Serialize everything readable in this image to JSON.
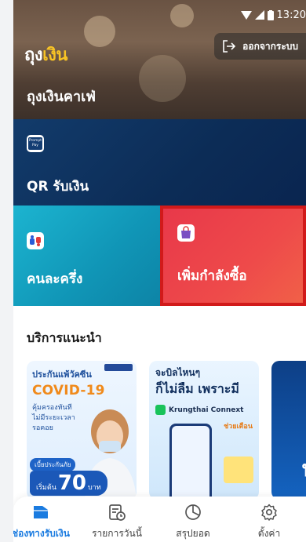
{
  "status_bar": {
    "time": "13:20"
  },
  "header": {
    "logo_part1": "ถุง",
    "logo_part2": "เงิน",
    "logout_label": "ออกจากระบบ",
    "shop_name": "ถุงเงินคาเฟ่"
  },
  "tiles": {
    "qr": {
      "icon_text_1": "Prompt",
      "icon_text_2": "Pay",
      "label": "QR รับเงิน"
    },
    "half": {
      "label": "คนละครึ่ง"
    },
    "boost": {
      "label": "เพิ่มกำลังซื้อ"
    }
  },
  "recommended": {
    "title": "บริการแนะนำ",
    "card1": {
      "title": "ประกันแพ้วัคซีน",
      "headline": "COVID-19",
      "sub_lines": [
        "คุ้มครองทันที",
        "ไม่มีระยะเวลา",
        "รอคอย"
      ],
      "badge": "เบี้ยประกันภัย",
      "price_prefix": "เริ่มต้น",
      "price_value": "70",
      "price_unit": "บาท"
    },
    "card2": {
      "title_line1": "จะบิลไหนๆ",
      "title_line2": "ก็ไม่ลืม เพราะมี",
      "app_name": "Krungthai Connext",
      "help_text": "ช่วยเตือน"
    },
    "card3": {
      "partial_text": "ฟ"
    }
  },
  "bottom_nav": {
    "items": [
      {
        "label": "ช่องทางรับเงิน",
        "icon": "wallet-icon",
        "active": true
      },
      {
        "label": "รายการวันนี้",
        "icon": "receipt-clock-icon",
        "active": false
      },
      {
        "label": "สรุปยอด",
        "icon": "pie-chart-icon",
        "active": false
      },
      {
        "label": "ตั้งค่า",
        "icon": "gear-icon",
        "active": false
      }
    ]
  },
  "colors": {
    "accent_blue": "#1a7be0",
    "qr_tile": "#0c2c56",
    "half_tile": "#1095b6",
    "boost_tile": "#ee4a4a",
    "highlight_border": "#d11a1a",
    "logo_accent": "#f7c325"
  }
}
